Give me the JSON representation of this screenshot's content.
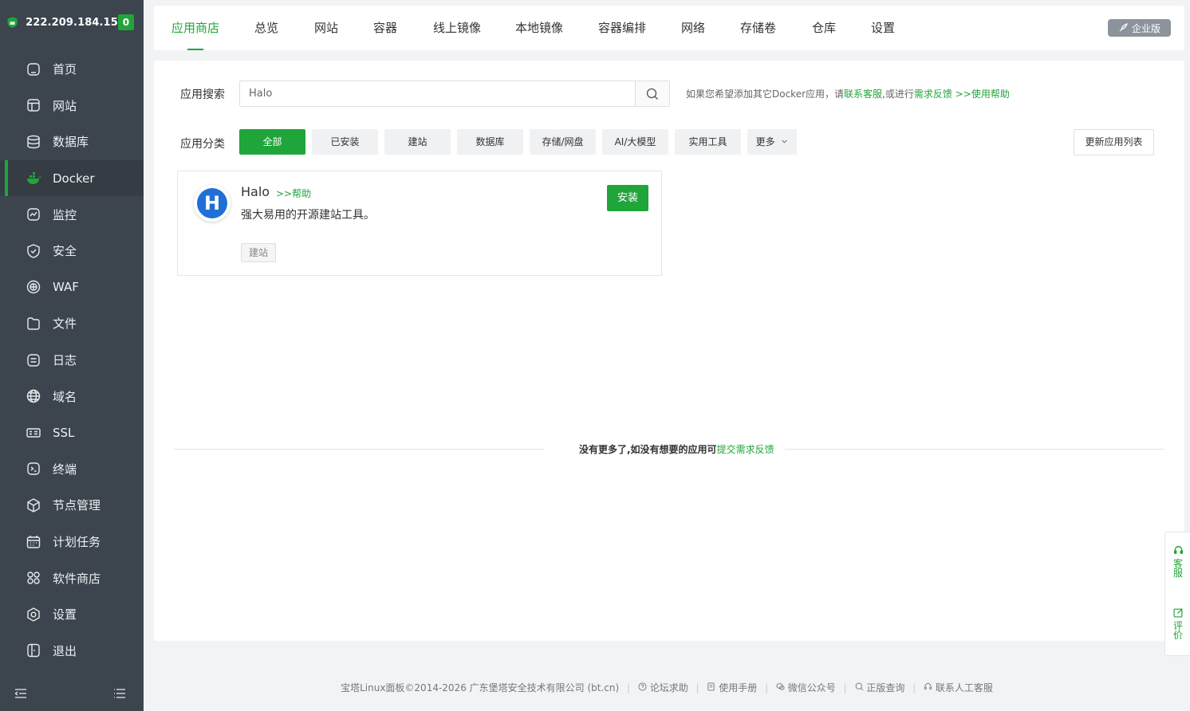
{
  "sidebar": {
    "ip": "222.209.184.15",
    "badge": "0",
    "items": [
      {
        "label": "首页",
        "icon": "home-icon"
      },
      {
        "label": "网站",
        "icon": "website-icon"
      },
      {
        "label": "数据库",
        "icon": "database-icon"
      },
      {
        "label": "Docker",
        "icon": "docker-icon"
      },
      {
        "label": "监控",
        "icon": "monitor-icon"
      },
      {
        "label": "安全",
        "icon": "shield-icon"
      },
      {
        "label": "WAF",
        "icon": "waf-icon"
      },
      {
        "label": "文件",
        "icon": "folder-icon"
      },
      {
        "label": "日志",
        "icon": "log-icon"
      },
      {
        "label": "域名",
        "icon": "globe-icon"
      },
      {
        "label": "SSL",
        "icon": "ssl-icon"
      },
      {
        "label": "终端",
        "icon": "terminal-icon"
      },
      {
        "label": "节点管理",
        "icon": "cube-icon"
      },
      {
        "label": "计划任务",
        "icon": "calendar-icon"
      },
      {
        "label": "软件商店",
        "icon": "apps-icon"
      },
      {
        "label": "设置",
        "icon": "settings-icon"
      },
      {
        "label": "退出",
        "icon": "exit-icon"
      }
    ],
    "active": "Docker"
  },
  "tabs": [
    "应用商店",
    "总览",
    "网站",
    "容器",
    "线上镜像",
    "本地镜像",
    "容器编排",
    "网络",
    "存储卷",
    "仓库",
    "设置"
  ],
  "active_tab": "应用商店",
  "enterprise_label": "企业版",
  "search": {
    "label": "应用搜索",
    "value": "Halo",
    "hint_pre": "如果您希望添加其它Docker应用，请",
    "hint_link1": "联系客服",
    "hint_mid": ",或进行",
    "hint_link2": "需求反馈",
    "hint_link3": ">>使用帮助"
  },
  "category": {
    "label": "应用分类",
    "items": [
      "全部",
      "已安装",
      "建站",
      "数据库",
      "存储/网盘",
      "AI/大模型",
      "实用工具",
      "更多"
    ],
    "active": "全部"
  },
  "refresh_label": "更新应用列表",
  "app_card": {
    "logo_letter": "H",
    "name": "Halo",
    "help": ">>帮助",
    "desc": "强大易用的开源建站工具。",
    "tag": "建站",
    "install": "安装"
  },
  "no_more": {
    "text": "没有更多了,如没有想要的应用可",
    "link": "提交需求反馈"
  },
  "footer": {
    "copyright": "宝塔Linux面板©2014-2026 广东堡塔安全技术有限公司 (bt.cn)",
    "links": [
      "论坛求助",
      "使用手册",
      "微信公众号",
      "正版查询",
      "联系人工客服"
    ]
  },
  "side_float": {
    "service": "客服",
    "rate": "评价"
  },
  "colors": {
    "accent": "#20a53a",
    "sidebar_bg": "#3c444d"
  }
}
